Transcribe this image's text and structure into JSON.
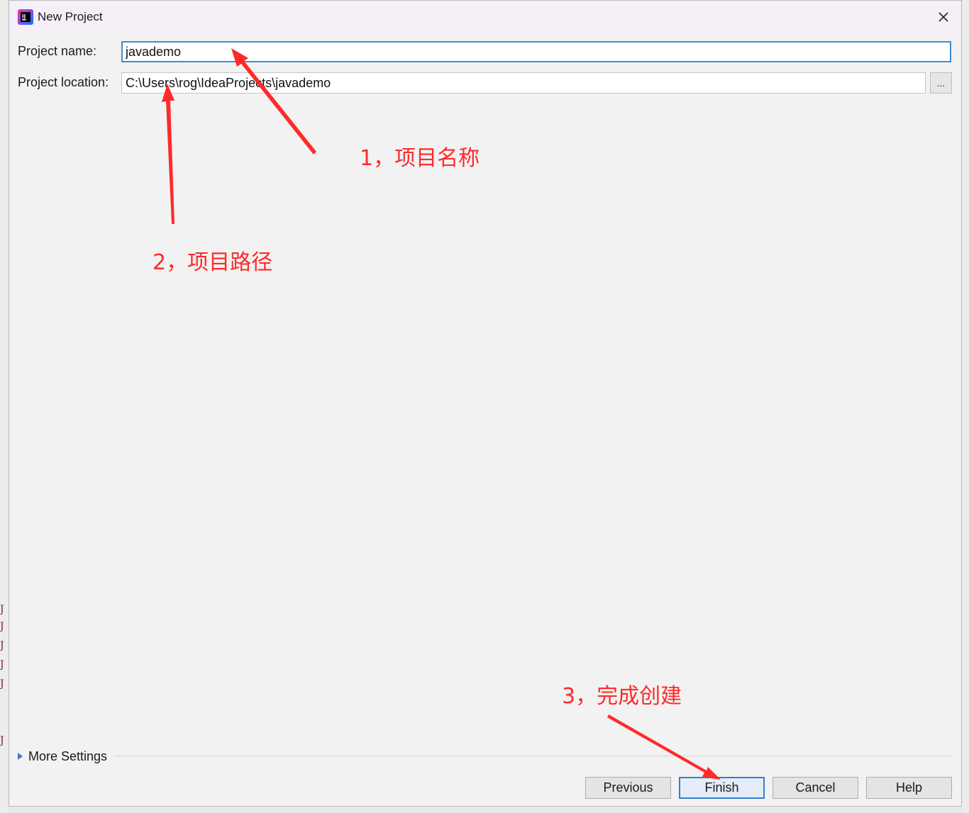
{
  "window": {
    "title": "New Project",
    "icon": "intellij-idea-icon",
    "close_icon": "close-icon"
  },
  "form": {
    "project_name_label": "Project name:",
    "project_name_value": "javademo",
    "project_location_label": "Project location:",
    "project_location_value": "C:\\Users\\rog\\IdeaProjects\\javademo",
    "browse_label": "..."
  },
  "more_settings": {
    "label": "More Settings",
    "icon": "triangle-right-icon"
  },
  "buttons": {
    "previous": "Previous",
    "finish": "Finish",
    "cancel": "Cancel",
    "help": "Help"
  },
  "annotations": {
    "step1": "1，项目名称",
    "step2": "2，项目路径",
    "step3": "3，完成创建",
    "color": "#ff2a2a"
  },
  "colors": {
    "focus_border": "#3d8bd9",
    "titlebar": "#f5eff8",
    "dialog_bg": "#f2f2f2"
  }
}
